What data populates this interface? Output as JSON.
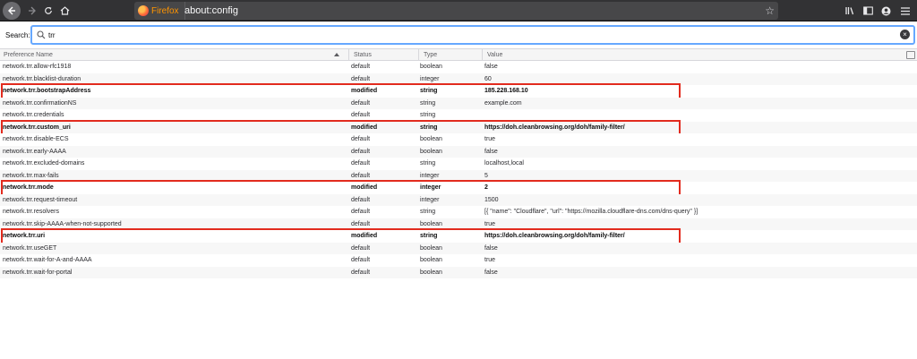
{
  "toolbar": {
    "identity_label": "Firefox",
    "url": "about:config"
  },
  "search": {
    "label": "Search:",
    "value": "trr",
    "placeholder": ""
  },
  "table": {
    "headers": {
      "name": "Preference Name",
      "status": "Status",
      "type": "Type",
      "value": "Value"
    },
    "rows": [
      {
        "name": "network.trr.allow-rfc1918",
        "status": "default",
        "type": "boolean",
        "value": "false",
        "modified": false
      },
      {
        "name": "network.trr.blacklist-duration",
        "status": "default",
        "type": "integer",
        "value": "60",
        "modified": false
      },
      {
        "name": "network.trr.bootstrapAddress",
        "status": "modified",
        "type": "string",
        "value": "185.228.168.10",
        "modified": true
      },
      {
        "name": "network.trr.confirmationNS",
        "status": "default",
        "type": "string",
        "value": "example.com",
        "modified": false
      },
      {
        "name": "network.trr.credentials",
        "status": "default",
        "type": "string",
        "value": "",
        "modified": false
      },
      {
        "name": "network.trr.custom_uri",
        "status": "modified",
        "type": "string",
        "value": "https://doh.cleanbrowsing.org/doh/family-filter/",
        "modified": true
      },
      {
        "name": "network.trr.disable-ECS",
        "status": "default",
        "type": "boolean",
        "value": "true",
        "modified": false
      },
      {
        "name": "network.trr.early-AAAA",
        "status": "default",
        "type": "boolean",
        "value": "false",
        "modified": false
      },
      {
        "name": "network.trr.excluded-domains",
        "status": "default",
        "type": "string",
        "value": "localhost,local",
        "modified": false
      },
      {
        "name": "network.trr.max-fails",
        "status": "default",
        "type": "integer",
        "value": "5",
        "modified": false
      },
      {
        "name": "network.trr.mode",
        "status": "modified",
        "type": "integer",
        "value": "2",
        "modified": true
      },
      {
        "name": "network.trr.request-timeout",
        "status": "default",
        "type": "integer",
        "value": "1500",
        "modified": false
      },
      {
        "name": "network.trr.resolvers",
        "status": "default",
        "type": "string",
        "value": "[{ \"name\": \"Cloudflare\", \"url\": \"https://mozilla.cloudflare-dns.com/dns-query\" }]",
        "modified": false
      },
      {
        "name": "network.trr.skip-AAAA-when-not-supported",
        "status": "default",
        "type": "boolean",
        "value": "true",
        "modified": false
      },
      {
        "name": "network.trr.uri",
        "status": "modified",
        "type": "string",
        "value": "https://doh.cleanbrowsing.org/doh/family-filter/",
        "modified": true
      },
      {
        "name": "network.trr.useGET",
        "status": "default",
        "type": "boolean",
        "value": "false",
        "modified": false
      },
      {
        "name": "network.trr.wait-for-A-and-AAAA",
        "status": "default",
        "type": "boolean",
        "value": "true",
        "modified": false
      },
      {
        "name": "network.trr.wait-for-portal",
        "status": "default",
        "type": "boolean",
        "value": "false",
        "modified": false
      }
    ]
  },
  "colors": {
    "highlight_box": "#e22b1e",
    "search_focus": "#66a8ff",
    "toolbar_bg": "#323234",
    "identity_label": "#ff9400"
  },
  "icons": [
    "back-icon",
    "forward-icon",
    "reload-icon",
    "home-icon",
    "firefox-logo",
    "star-icon",
    "library-icon",
    "sidebar-icon",
    "account-icon",
    "menu-icon",
    "search-icon",
    "clear-icon",
    "sort-ascending-icon",
    "column-picker-icon"
  ]
}
